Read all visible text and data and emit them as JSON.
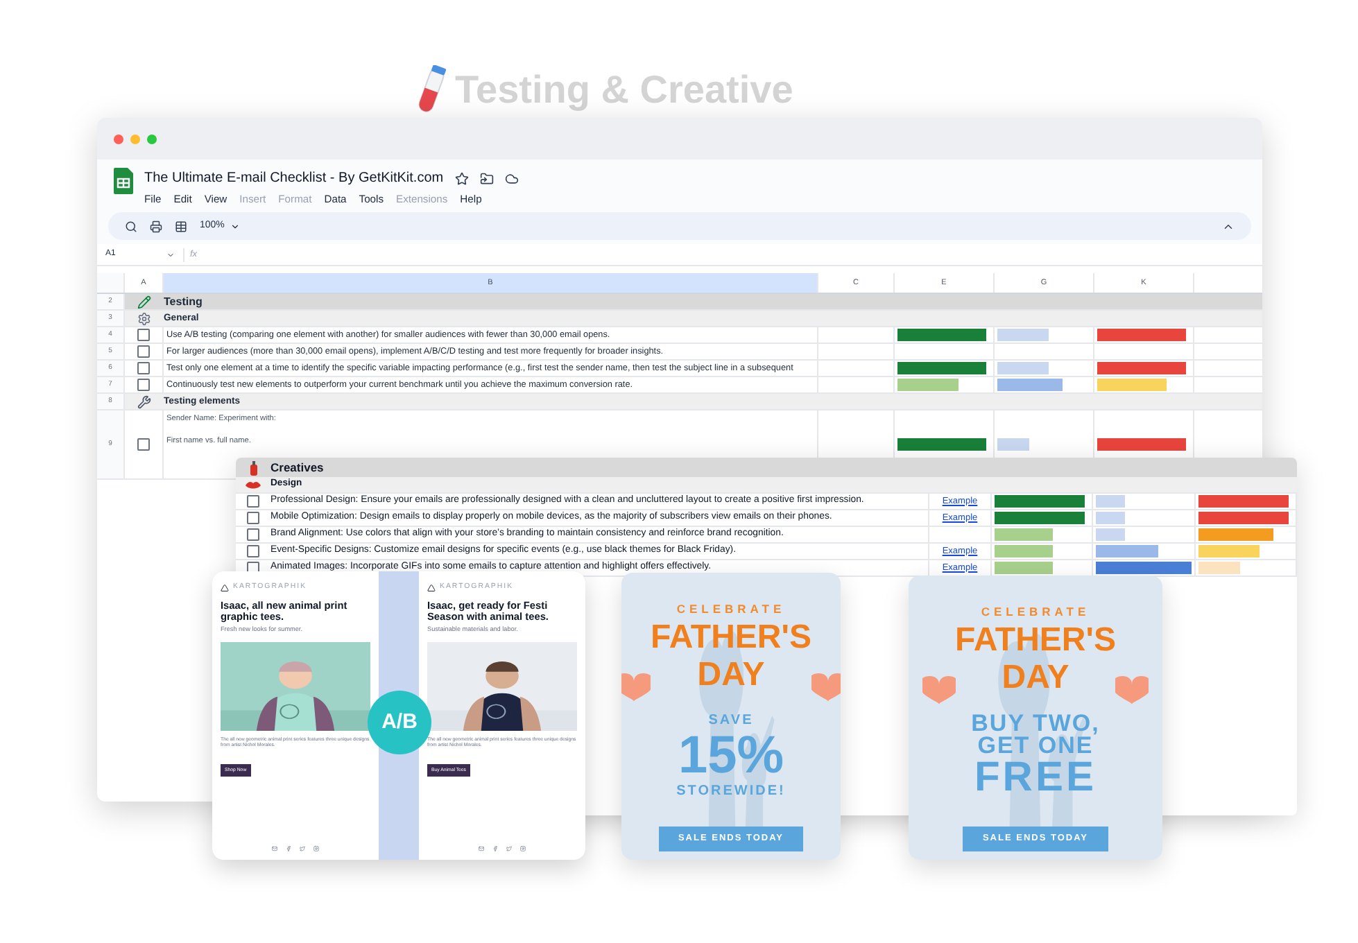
{
  "heading": {
    "text": "Testing & Creative"
  },
  "sheet": {
    "title": "The Ultimate E-mail Checklist - By GetKitKit.com",
    "menu": [
      {
        "label": "File",
        "disabled": false
      },
      {
        "label": "Edit",
        "disabled": false
      },
      {
        "label": "View",
        "disabled": false
      },
      {
        "label": "Insert",
        "disabled": true
      },
      {
        "label": "Format",
        "disabled": true
      },
      {
        "label": "Data",
        "disabled": false
      },
      {
        "label": "Tools",
        "disabled": false
      },
      {
        "label": "Extensions",
        "disabled": true
      },
      {
        "label": "Help",
        "disabled": false
      }
    ],
    "zoom": "100%",
    "name_box": "A1",
    "formula_label": "fx",
    "columns": [
      "A",
      "B",
      "C",
      "E",
      "G",
      "K"
    ],
    "rows": [
      {
        "num": "2",
        "kind": "section",
        "text": "Testing"
      },
      {
        "num": "3",
        "kind": "subsection",
        "text": "General"
      },
      {
        "num": "4",
        "kind": "item",
        "checked": false,
        "text": "Use A/B testing (comparing one element with another) for smaller audiences with fewer than 30,000 email opens.",
        "bars": [
          {
            "color": "#188038",
            "level": 0.95
          },
          {
            "color": "#c9d7f0",
            "level": 0.55
          },
          {
            "color": "#e8453c",
            "level": 0.95
          }
        ]
      },
      {
        "num": "5",
        "kind": "item",
        "checked": false,
        "text": "For larger audiences (more than 30,000 email opens), implement A/B/C/D testing and test more frequently for broader insights."
      },
      {
        "num": "6",
        "kind": "item",
        "checked": false,
        "text": "Test only one element at a time to identify the specific variable impacting performance (e.g., first test the sender name, then test the subject line in a subsequent",
        "bars": [
          {
            "color": "#188038",
            "level": 0.95
          },
          {
            "color": "#c9d7f0",
            "level": 0.55
          },
          {
            "color": "#e8453c",
            "level": 0.95
          }
        ]
      },
      {
        "num": "7",
        "kind": "item",
        "checked": false,
        "text": "Continuously test new elements to outperform your current benchmark until you achieve the maximum conversion rate.",
        "bars": [
          {
            "color": "#a8d08d",
            "level": 0.65
          },
          {
            "color": "#9ab9e8",
            "level": 0.7
          },
          {
            "color": "#f9d45c",
            "level": 0.75
          }
        ]
      },
      {
        "num": "8",
        "kind": "section_small",
        "text": "Testing elements"
      },
      {
        "num": "9",
        "kind": "tall",
        "checked": false,
        "lines": [
          "Sender Name: Experiment with:",
          "First name vs. full name."
        ],
        "bars": [
          {
            "color": "#188038",
            "level": 0.95
          },
          {
            "color": "#c9d7f0",
            "level": 0.35
          },
          {
            "color": "#e8453c",
            "level": 0.95
          }
        ]
      }
    ]
  },
  "creatives": {
    "title": "Creatives",
    "subtitle": "Design",
    "rows": [
      {
        "checked": false,
        "text": "Professional Design: Ensure your emails are professionally designed with a clean and uncluttered layout to create a positive first impression.",
        "link": "Example",
        "bars": [
          {
            "color": "#188038",
            "level": 0.95
          },
          {
            "color": "#c9d7f0",
            "level": 0.3
          },
          {
            "color": "#e8453c",
            "level": 0.95
          }
        ]
      },
      {
        "checked": false,
        "text": "Mobile Optimization: Design emails to display properly on mobile devices, as the majority of subscribers view emails on their phones.",
        "link": "Example",
        "bars": [
          {
            "color": "#188038",
            "level": 0.95
          },
          {
            "color": "#c9d7f0",
            "level": 0.3
          },
          {
            "color": "#e8453c",
            "level": 0.95
          }
        ]
      },
      {
        "checked": false,
        "text": "Brand Alignment: Use colors that align with your store’s branding to maintain consistency and reinforce brand recognition.",
        "bars": [
          {
            "color": "#a8d08d",
            "level": 0.62
          },
          {
            "color": "#c9d7f0",
            "level": 0.3
          },
          {
            "color": "#f39c1f",
            "level": 0.8
          }
        ]
      },
      {
        "checked": false,
        "text": "Event-Specific Designs: Customize email designs for specific events (e.g., use black themes for Black Friday).",
        "link": "Example",
        "bars": [
          {
            "color": "#a8d08d",
            "level": 0.62
          },
          {
            "color": "#9ab9e8",
            "level": 0.65
          },
          {
            "color": "#f9d45c",
            "level": 0.65
          }
        ]
      },
      {
        "checked": false,
        "text": "Animated Images: Incorporate GIFs into some emails to capture attention and highlight offers effectively.",
        "link": "Example",
        "bars": [
          {
            "color": "#a8d08d",
            "level": 0.62
          },
          {
            "color": "#4a7fd6",
            "level": 1
          },
          {
            "color": "#fde2c0",
            "level": 0.45
          }
        ]
      }
    ]
  },
  "ab_test": {
    "badge": "A/B",
    "emails": [
      {
        "logo": "KARTOGRAPHIK",
        "headline": "Isaac, all new animal print graphic tees.",
        "subline": "Fresh new looks for summer.",
        "body": "The all new geometric animal print series features three unique designs from artist Nichol Morales.",
        "button": "Shop Now"
      },
      {
        "logo": "KARTOGRAPHIK",
        "headline": "Isaac, get ready for Festi Season with animal tees.",
        "subline": "Sustainable materials and labor.",
        "body": "The all new geometric animal print series features three unique designs from artist Nichol Morales.",
        "button": "Buy Animal Tees"
      }
    ]
  },
  "promos": [
    {
      "kicker": "CELEBRATE",
      "title_lines": [
        "FATHER'S",
        "DAY"
      ],
      "offer_lines": [
        {
          "text": "SAVE",
          "kind": "small"
        },
        {
          "text": "15%",
          "kind": "huge"
        },
        {
          "text": "STOREWIDE!",
          "kind": "small"
        }
      ],
      "button": "SALE ENDS TODAY"
    },
    {
      "kicker": "CELEBRATE",
      "title_lines": [
        "FATHER'S",
        "DAY"
      ],
      "offer_lines": [
        {
          "text": "BUY TWO,",
          "kind": "medium"
        },
        {
          "text": "GET ONE",
          "kind": "medium"
        },
        {
          "text": "FREE",
          "kind": "large"
        }
      ],
      "button": "SALE ENDS TODAY"
    }
  ]
}
